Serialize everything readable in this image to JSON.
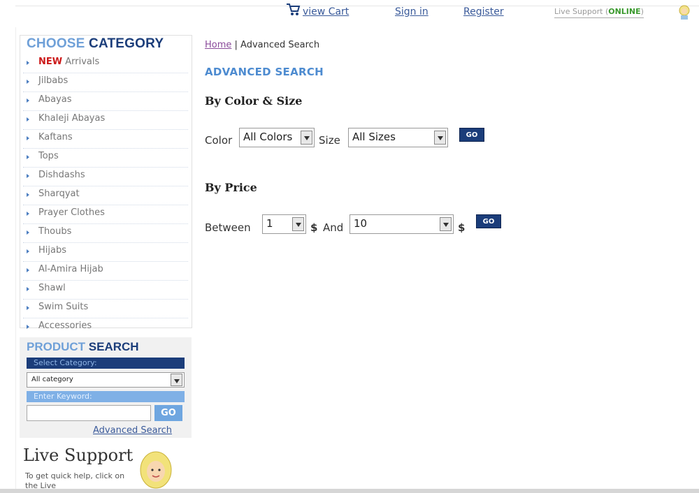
{
  "topbar": {
    "cart_label": "view Cart",
    "signin_label": "Sign in",
    "register_label": "Register",
    "live_support_label": "Live Support (",
    "online_label": "ONLINE",
    "live_support_close": ")"
  },
  "sidebar": {
    "title_part1": "CHOOSE",
    "title_part2": "CATEGORY",
    "new_label": "NEW",
    "items": [
      {
        "label": " Arrivals"
      },
      {
        "label": "Jilbabs"
      },
      {
        "label": "Abayas"
      },
      {
        "label": "Khaleji Abayas"
      },
      {
        "label": "Kaftans"
      },
      {
        "label": "Tops"
      },
      {
        "label": "Dishdashs"
      },
      {
        "label": "Sharqyat"
      },
      {
        "label": "Prayer Clothes"
      },
      {
        "label": "Thoubs"
      },
      {
        "label": "Hijabs"
      },
      {
        "label": "Al-Amira Hijab"
      },
      {
        "label": "Shawl"
      },
      {
        "label": "Swim Suits"
      },
      {
        "label": "Accessories"
      }
    ]
  },
  "product_search": {
    "title_part1": "PRODUCT",
    "title_part2": "SEARCH",
    "select_category_label": "Select Category:",
    "category_value": "All category",
    "keyword_label": "Enter Keyword:",
    "keyword_value": "",
    "go_label": "GO",
    "advanced_link": "Advanced Search"
  },
  "live_support": {
    "title": "Live Support",
    "text": "To get quick help, click on the Live"
  },
  "main": {
    "breadcrumb_home": "Home",
    "breadcrumb_sep": " | ",
    "breadcrumb_current": "Advanced Search",
    "page_title": "ADVANCED SEARCH",
    "color_size_heading": "By Color & Size",
    "color_label": "Color",
    "color_value": "All Colors",
    "size_label": "Size",
    "size_value": "All Sizes",
    "go_label": "GO",
    "price_heading": "By Price",
    "between_label": "Between",
    "price_from": "1",
    "dollar1": "$",
    "and_label": "And",
    "price_to": "10",
    "dollar2": "$"
  },
  "colors": {
    "brand_dark": "#1b3d7a",
    "brand_light": "#6fa0d8",
    "new_red": "#cc1a1a",
    "online_green": "#3b9a2e"
  }
}
